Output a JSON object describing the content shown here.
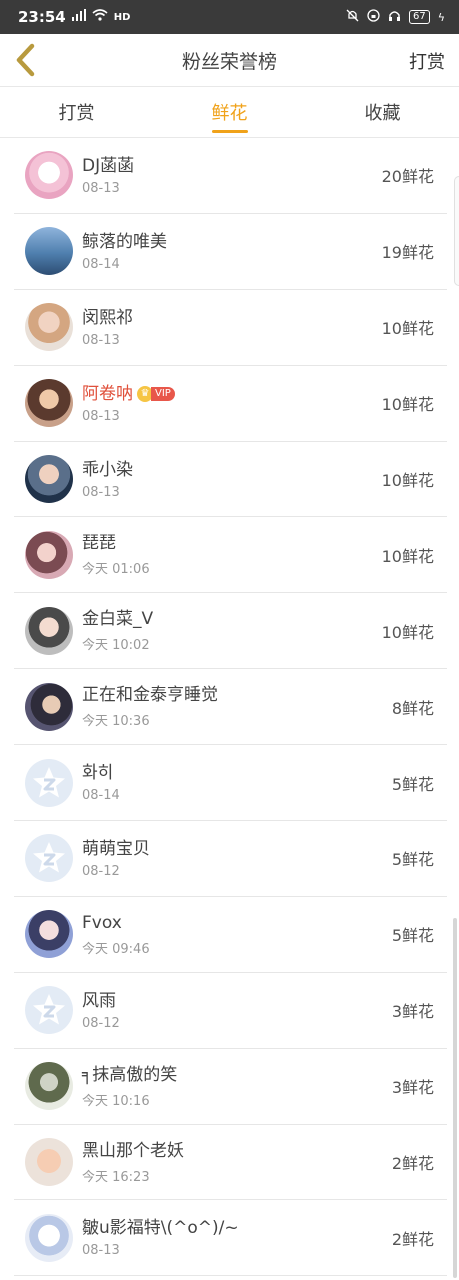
{
  "status_bar": {
    "time": "23:54",
    "network": "4G",
    "hd": "HD",
    "battery": "67"
  },
  "nav": {
    "title": "粉丝荣誉榜",
    "right_action": "打赏"
  },
  "tabs": [
    {
      "label": "打赏",
      "active": false
    },
    {
      "label": "鲜花",
      "active": true
    },
    {
      "label": "收藏",
      "active": false
    }
  ],
  "vip_label": "VIP",
  "fans": [
    {
      "name": "DJ菡菡",
      "date": "08-13",
      "count": "20鲜花",
      "avatar": "pink-floral-avatar"
    },
    {
      "name": "鲸落的唯美",
      "date": "08-14",
      "count": "19鲜花",
      "avatar": "sky-avatar"
    },
    {
      "name": "闵熙祁",
      "date": "08-13",
      "count": "10鲜花",
      "avatar": "portrait-avatar"
    },
    {
      "name": "阿卷呐",
      "date": "08-13",
      "count": "10鲜花",
      "avatar": "portrait-avatar",
      "vip": true
    },
    {
      "name": "乖小染",
      "date": "08-13",
      "count": "10鲜花",
      "avatar": "portrait-avatar"
    },
    {
      "name": "琵琵",
      "date": "今天 01:06",
      "count": "10鲜花",
      "avatar": "portrait-avatar"
    },
    {
      "name": "金白菜_V",
      "date": "今天 10:02",
      "count": "10鲜花",
      "avatar": "portrait-avatar"
    },
    {
      "name": "正在和金泰亨睡觉",
      "date": "今天 10:36",
      "count": "8鲜花",
      "avatar": "portrait-avatar"
    },
    {
      "name": "화히",
      "date": "08-14",
      "count": "5鲜花",
      "avatar": "default-avatar"
    },
    {
      "name": "萌萌宝贝",
      "date": "08-12",
      "count": "5鲜花",
      "avatar": "default-avatar"
    },
    {
      "name": "Fvox",
      "date": "今天 09:46",
      "count": "5鲜花",
      "avatar": "portrait-avatar"
    },
    {
      "name": "风雨",
      "date": "08-12",
      "count": "3鲜花",
      "avatar": "default-avatar"
    },
    {
      "name": "╕抹高傲的笑",
      "date": "今天 10:16",
      "count": "3鲜花",
      "avatar": "portrait-avatar"
    },
    {
      "name": "黑山那个老妖",
      "date": "今天 16:23",
      "count": "2鲜花",
      "avatar": "baby-avatar"
    },
    {
      "name": "皺u影福特\\(^o^)/~",
      "date": "08-13",
      "count": "2鲜花",
      "avatar": "anime-avatar"
    }
  ],
  "colors": {
    "accent": "#f0a21a",
    "vip_name": "#e0503b",
    "status_bar": "#3a3a3a"
  }
}
